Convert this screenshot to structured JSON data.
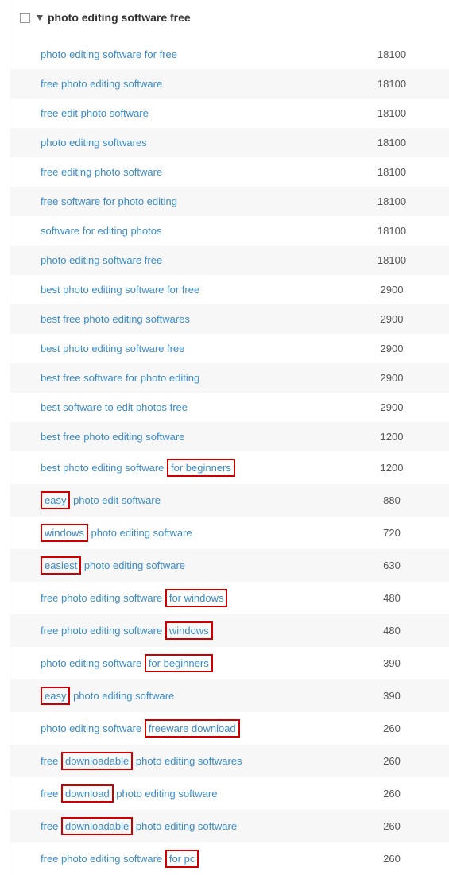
{
  "header": {
    "title": "photo editing software free"
  },
  "rows": [
    {
      "segments": [
        {
          "text": "photo editing software for free",
          "hl": false
        }
      ],
      "value": "18100"
    },
    {
      "segments": [
        {
          "text": "free photo editing software",
          "hl": false
        }
      ],
      "value": "18100"
    },
    {
      "segments": [
        {
          "text": "free edit photo software",
          "hl": false
        }
      ],
      "value": "18100"
    },
    {
      "segments": [
        {
          "text": "photo editing softwares",
          "hl": false
        }
      ],
      "value": "18100"
    },
    {
      "segments": [
        {
          "text": "free editing photo software",
          "hl": false
        }
      ],
      "value": "18100"
    },
    {
      "segments": [
        {
          "text": "free software for photo editing",
          "hl": false
        }
      ],
      "value": "18100"
    },
    {
      "segments": [
        {
          "text": "software for editing photos",
          "hl": false
        }
      ],
      "value": "18100"
    },
    {
      "segments": [
        {
          "text": "photo editing software free",
          "hl": false
        }
      ],
      "value": "18100"
    },
    {
      "segments": [
        {
          "text": "best photo editing software for free",
          "hl": false
        }
      ],
      "value": "2900"
    },
    {
      "segments": [
        {
          "text": "best free photo editing softwares",
          "hl": false
        }
      ],
      "value": "2900"
    },
    {
      "segments": [
        {
          "text": "best photo editing software free",
          "hl": false
        }
      ],
      "value": "2900"
    },
    {
      "segments": [
        {
          "text": "best free software for photo editing",
          "hl": false
        }
      ],
      "value": "2900"
    },
    {
      "segments": [
        {
          "text": "best software to edit photos free",
          "hl": false
        }
      ],
      "value": "2900"
    },
    {
      "segments": [
        {
          "text": "best free photo editing software",
          "hl": false
        }
      ],
      "value": "1200"
    },
    {
      "segments": [
        {
          "text": "best photo editing software ",
          "hl": false
        },
        {
          "text": "for beginners",
          "hl": true
        }
      ],
      "value": "1200"
    },
    {
      "segments": [
        {
          "text": "easy",
          "hl": true
        },
        {
          "text": " photo edit software",
          "hl": false
        }
      ],
      "value": "880"
    },
    {
      "segments": [
        {
          "text": "windows",
          "hl": true
        },
        {
          "text": " photo editing software",
          "hl": false
        }
      ],
      "value": "720"
    },
    {
      "segments": [
        {
          "text": "easiest",
          "hl": true
        },
        {
          "text": " photo editing software",
          "hl": false
        }
      ],
      "value": "630"
    },
    {
      "segments": [
        {
          "text": "free photo editing software ",
          "hl": false
        },
        {
          "text": "for windows",
          "hl": true
        }
      ],
      "value": "480"
    },
    {
      "segments": [
        {
          "text": "free photo editing software ",
          "hl": false
        },
        {
          "text": "windows",
          "hl": true
        }
      ],
      "value": "480"
    },
    {
      "segments": [
        {
          "text": "photo editing software ",
          "hl": false
        },
        {
          "text": "for beginners",
          "hl": true
        }
      ],
      "value": "390"
    },
    {
      "segments": [
        {
          "text": "easy",
          "hl": true
        },
        {
          "text": " photo editing software",
          "hl": false
        }
      ],
      "value": "390"
    },
    {
      "segments": [
        {
          "text": "photo editing software ",
          "hl": false
        },
        {
          "text": "freeware download",
          "hl": true
        }
      ],
      "value": "260"
    },
    {
      "segments": [
        {
          "text": "free ",
          "hl": false
        },
        {
          "text": "downloadable",
          "hl": true
        },
        {
          "text": " photo editing softwares",
          "hl": false
        }
      ],
      "value": "260"
    },
    {
      "segments": [
        {
          "text": "free ",
          "hl": false
        },
        {
          "text": "download",
          "hl": true
        },
        {
          "text": " photo editing software",
          "hl": false
        }
      ],
      "value": "260"
    },
    {
      "segments": [
        {
          "text": "free ",
          "hl": false
        },
        {
          "text": "downloadable",
          "hl": true
        },
        {
          "text": " photo editing software",
          "hl": false
        }
      ],
      "value": "260"
    },
    {
      "segments": [
        {
          "text": "free photo editing software ",
          "hl": false
        },
        {
          "text": "for pc",
          "hl": true
        }
      ],
      "value": "260"
    }
  ]
}
